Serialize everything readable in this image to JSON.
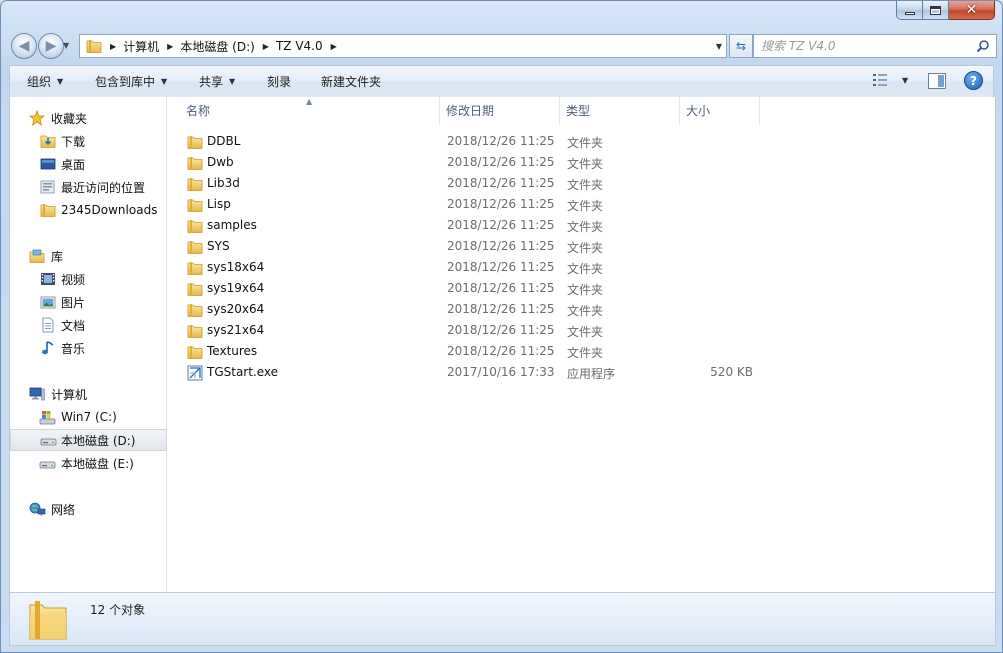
{
  "window": {
    "close_glyph": "✕"
  },
  "nav": {
    "back_glyph": "◀",
    "forward_glyph": "▶"
  },
  "address": {
    "breadcrumbs": [
      "计算机",
      "本地磁盘 (D:)",
      "TZ V4.0"
    ]
  },
  "search": {
    "placeholder": "搜索 TZ V4.0"
  },
  "toolbar": {
    "organize": "组织",
    "include_in_library": "包含到库中",
    "share": "共享",
    "burn": "刻录",
    "new_folder": "新建文件夹",
    "help_glyph": "?"
  },
  "sidebar": {
    "favorites": {
      "title": "收藏夹",
      "items": [
        "下载",
        "桌面",
        "最近访问的位置",
        "2345Downloads"
      ]
    },
    "libraries": {
      "title": "库",
      "items": [
        "视频",
        "图片",
        "文档",
        "音乐"
      ]
    },
    "computer": {
      "title": "计算机",
      "items": [
        "Win7 (C:)",
        "本地磁盘 (D:)",
        "本地磁盘 (E:)"
      ],
      "selected": "本地磁盘 (D:)"
    },
    "network": {
      "title": "网络"
    }
  },
  "columns": {
    "name": "名称",
    "date": "修改日期",
    "type": "类型",
    "size": "大小"
  },
  "files": [
    {
      "name": "DDBL",
      "date": "2018/12/26 11:25",
      "type": "文件夹",
      "size": "",
      "icon": "folder-icon"
    },
    {
      "name": "Dwb",
      "date": "2018/12/26 11:25",
      "type": "文件夹",
      "size": "",
      "icon": "folder-icon"
    },
    {
      "name": "Lib3d",
      "date": "2018/12/26 11:25",
      "type": "文件夹",
      "size": "",
      "icon": "folder-icon"
    },
    {
      "name": "Lisp",
      "date": "2018/12/26 11:25",
      "type": "文件夹",
      "size": "",
      "icon": "folder-icon"
    },
    {
      "name": "samples",
      "date": "2018/12/26 11:25",
      "type": "文件夹",
      "size": "",
      "icon": "folder-icon"
    },
    {
      "name": "SYS",
      "date": "2018/12/26 11:25",
      "type": "文件夹",
      "size": "",
      "icon": "folder-icon"
    },
    {
      "name": "sys18x64",
      "date": "2018/12/26 11:25",
      "type": "文件夹",
      "size": "",
      "icon": "folder-icon"
    },
    {
      "name": "sys19x64",
      "date": "2018/12/26 11:25",
      "type": "文件夹",
      "size": "",
      "icon": "folder-icon"
    },
    {
      "name": "sys20x64",
      "date": "2018/12/26 11:25",
      "type": "文件夹",
      "size": "",
      "icon": "folder-icon"
    },
    {
      "name": "sys21x64",
      "date": "2018/12/26 11:25",
      "type": "文件夹",
      "size": "",
      "icon": "folder-icon"
    },
    {
      "name": "Textures",
      "date": "2018/12/26 11:25",
      "type": "文件夹",
      "size": "",
      "icon": "folder-icon"
    },
    {
      "name": "TGStart.exe",
      "date": "2017/10/16 17:33",
      "type": "应用程序",
      "size": "520 KB",
      "icon": "exe-icon"
    }
  ],
  "status": {
    "count_text": "12 个对象"
  },
  "colors": {
    "folder": "#f2c94c",
    "selection": "#e1e5ea",
    "chrome": "#c9dcf1"
  }
}
